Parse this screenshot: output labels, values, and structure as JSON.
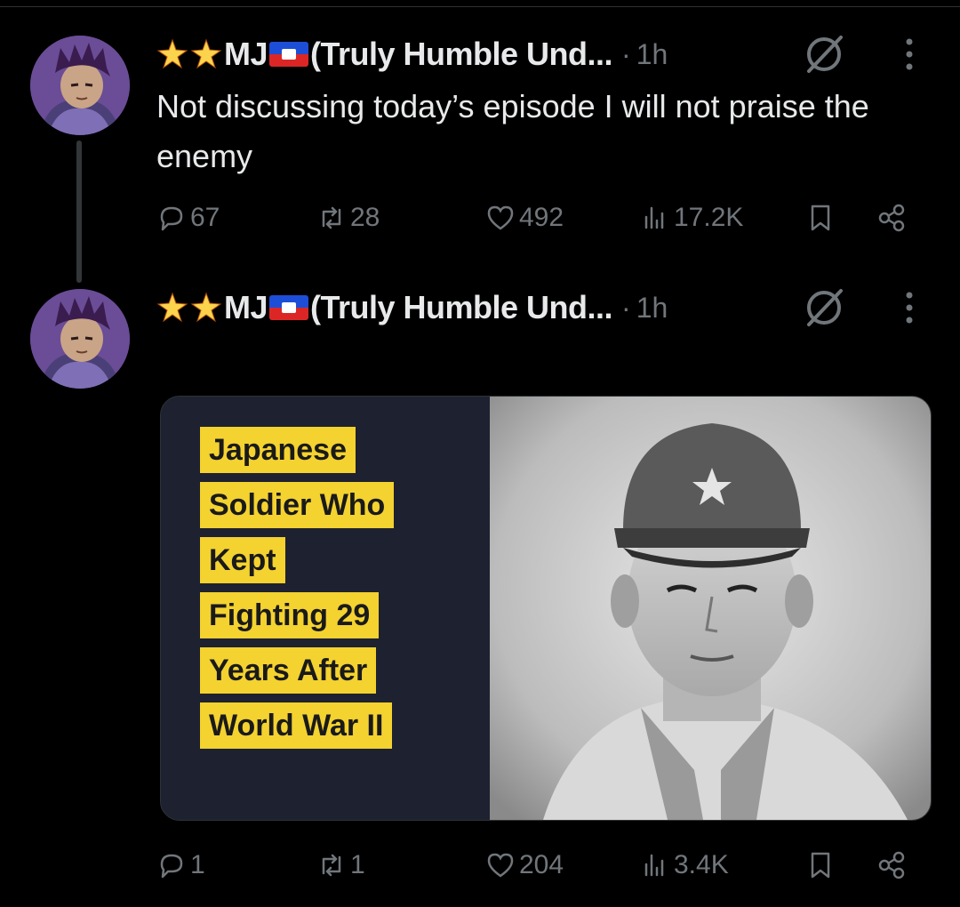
{
  "tweets": [
    {
      "author_name": "MJ",
      "author_name_suffix": "(Truly Humble Und...",
      "separator": "·",
      "time": "1h",
      "text": "Not discussing today’s episode I will not praise the enemy",
      "replies": "67",
      "reposts": "28",
      "likes": "492",
      "views": "17.2K"
    },
    {
      "author_name": "MJ",
      "author_name_suffix": "(Truly Humble Und...",
      "separator": "·",
      "time": "1h",
      "media_caption_lines": [
        "Japanese",
        "Soldier Who",
        "Kept",
        "Fighting 29",
        "Years After",
        "World War II"
      ],
      "replies": "1",
      "reposts": "1",
      "likes": "204",
      "views": "3.4K"
    }
  ],
  "icons": {
    "reply": "reply-icon",
    "repost": "repost-icon",
    "like": "heart-icon",
    "views": "views-icon",
    "bookmark": "bookmark-icon",
    "share": "share-icon",
    "grok": "grok-icon",
    "more": "more-icon",
    "stars": "sparkle-star-icon",
    "flag": "haiti-flag-icon"
  },
  "colors": {
    "background": "#000000",
    "text": "#e7e9ea",
    "muted": "#71767b",
    "caption_bg": "#f4d230",
    "media_left_bg": "#1e2130",
    "thread_line": "#333639"
  }
}
